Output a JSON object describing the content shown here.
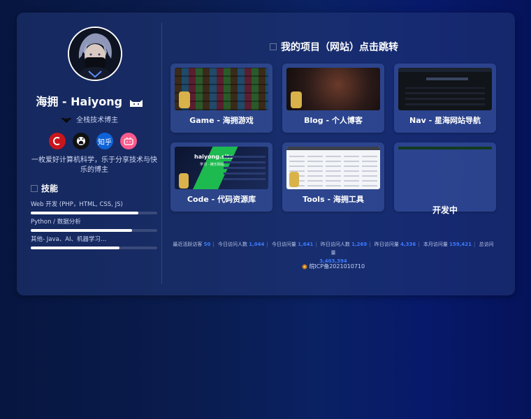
{
  "profile": {
    "name": "海拥 - Haiyong",
    "role": "全栈技术博主",
    "bio": "一枚爱好计算机科学，乐于分享技术与快乐的博主",
    "socials": [
      {
        "name": "csdn",
        "glyph": "C",
        "color": "#c8161d"
      },
      {
        "name": "github",
        "glyph": "",
        "color": "#111111"
      },
      {
        "name": "zhihu",
        "glyph": "知乎",
        "color": "#0d62d8"
      },
      {
        "name": "bilibili",
        "glyph": "",
        "color": "#fb5a8c"
      }
    ]
  },
  "skills": {
    "title": "技能",
    "items": [
      {
        "label": "Web 开发 (PHP，HTML, CSS, JS)",
        "level": 0.85
      },
      {
        "label": "Python / 数据分析",
        "level": 0.8
      },
      {
        "label": "其他- Java、AI、机器学习...",
        "level": 0.7
      }
    ]
  },
  "projects": {
    "title": "我的项目（网站）点击跳转",
    "items": [
      {
        "label": "Game - 海拥游戏"
      },
      {
        "label": "Blog - 个人博客"
      },
      {
        "label": "Nav - 星海网站导航"
      },
      {
        "label": "Code - 代码资源库",
        "thumb_text": "haiyong.site",
        "thumb_sub": "学习 · 娱乐网站"
      },
      {
        "label": "Tools - 海拥工具"
      },
      {
        "label": "开发中"
      }
    ]
  },
  "stats": [
    {
      "label": "最近活跃访客",
      "value": "50"
    },
    {
      "label": "今日访问人数",
      "value": "1,044"
    },
    {
      "label": "今日访问量",
      "value": "1,641"
    },
    {
      "label": "昨日访问人数",
      "value": "1,269"
    },
    {
      "label": "昨日访问量",
      "value": "4,336"
    },
    {
      "label": "本月访问量",
      "value": "159,421"
    },
    {
      "label": "总访问量",
      "value": "3,403,394"
    }
  ],
  "footer": {
    "icp": "皖ICP备2021010710"
  }
}
